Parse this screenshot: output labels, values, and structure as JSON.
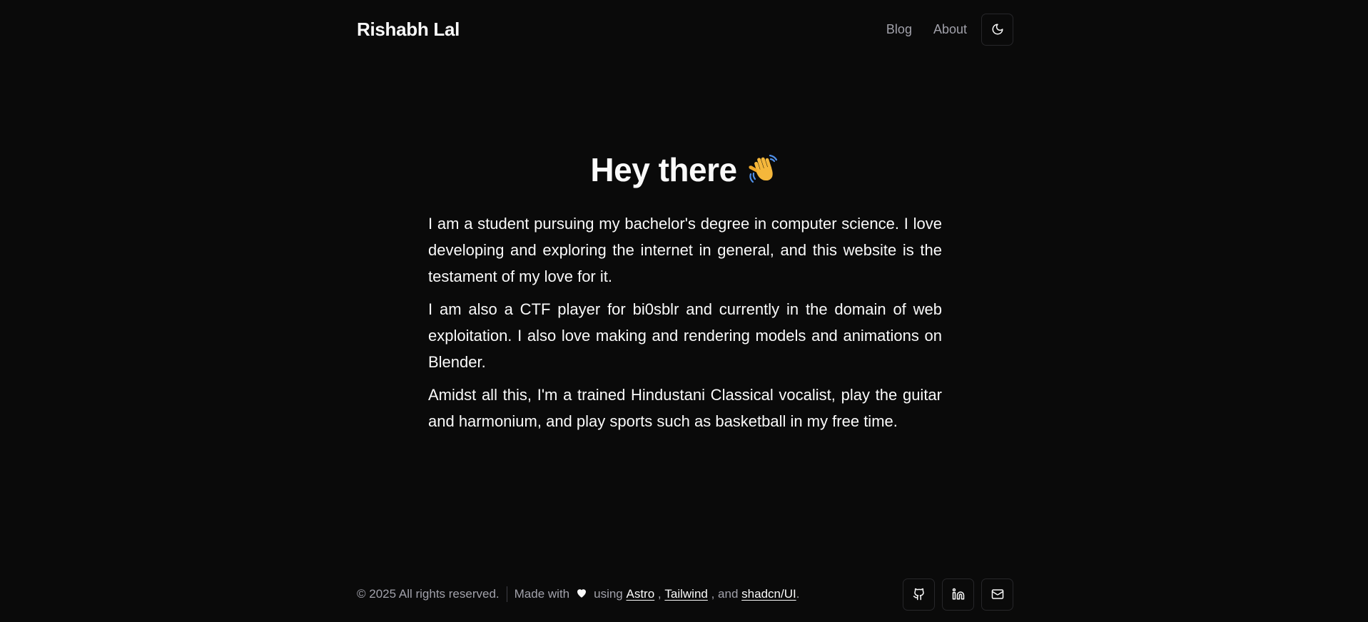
{
  "header": {
    "site_title": "Rishabh Lal",
    "nav": [
      {
        "label": "Blog"
      },
      {
        "label": "About"
      }
    ],
    "theme_toggle_icon": "moon-icon"
  },
  "main": {
    "title": "Hey there",
    "title_emoji": "waving-hand-icon",
    "paragraphs": [
      "I am a student pursuing my bachelor's degree in computer science. I love developing and exploring the internet in general, and this website is the testament of my love for it.",
      "I am also a CTF player for bi0sblr and currently in the domain of web exploitation. I also love making and rendering models and animations on Blender.",
      "Amidst all this, I'm a trained Hindustani Classical vocalist, play the guitar and harmonium, and play sports such as basketball in my free time."
    ]
  },
  "footer": {
    "copyright": "© 2025 All rights reserved.",
    "made_with": "Made with",
    "using": "using",
    "links": [
      {
        "label": "Astro"
      },
      {
        "label": "Tailwind"
      },
      {
        "label": "shadcn/UI"
      }
    ],
    "comma": ",",
    "and": ", and",
    "period": ".",
    "socials": [
      {
        "icon": "github-icon"
      },
      {
        "icon": "linkedin-icon"
      },
      {
        "icon": "mail-icon"
      }
    ]
  },
  "colors": {
    "background": "#0a0a0a",
    "text": "#fafafa",
    "muted": "#a1a1aa",
    "border": "#27272a",
    "wave_emoji": "#f5b73b"
  }
}
